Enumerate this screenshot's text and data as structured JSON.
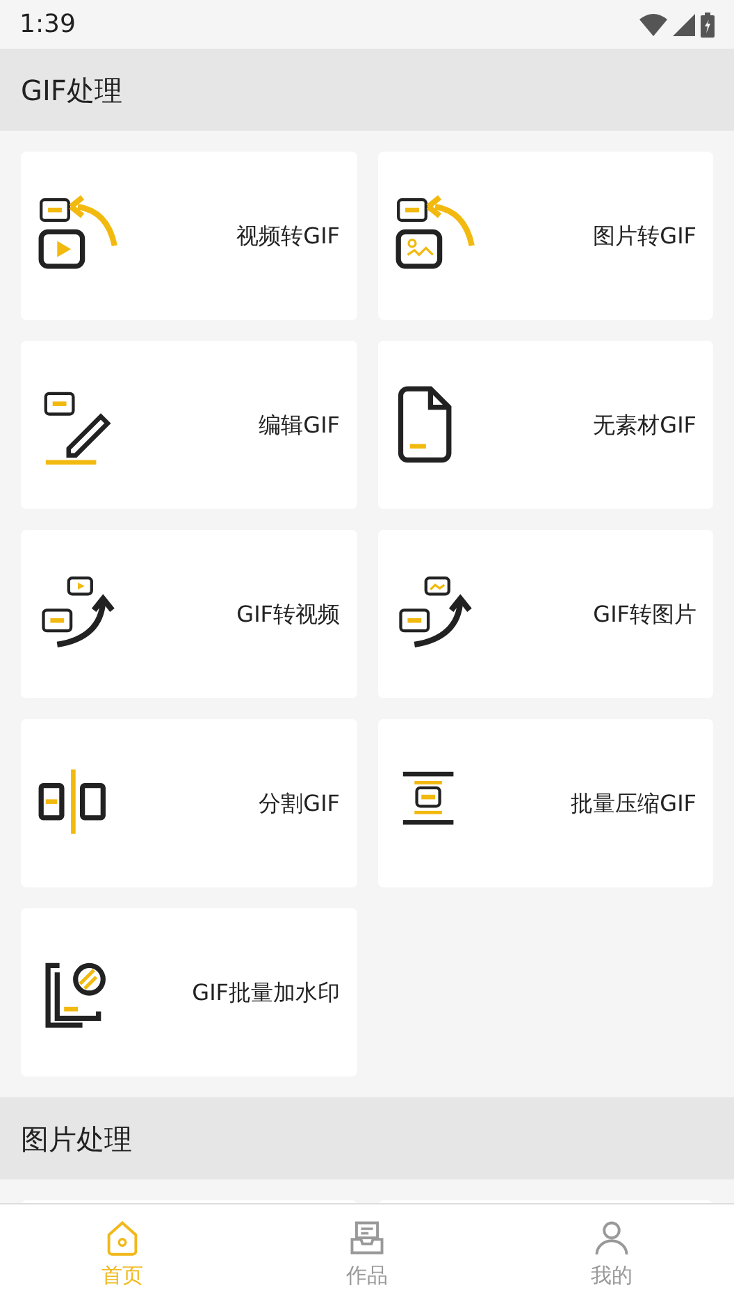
{
  "status_bar": {
    "time": "1:39"
  },
  "sections": [
    {
      "title": "GIF处理",
      "tools": [
        {
          "label": "视频转GIF",
          "kind": "video_to_gif"
        },
        {
          "label": "图片转GIF",
          "kind": "image_to_gif"
        },
        {
          "label": "编辑GIF",
          "kind": "edit"
        },
        {
          "label": "无素材GIF",
          "kind": "blank"
        },
        {
          "label": "GIF转视频",
          "kind": "gif_to_video"
        },
        {
          "label": "GIF转图片",
          "kind": "gif_to_image"
        },
        {
          "label": "分割GIF",
          "kind": "split"
        },
        {
          "label": "批量压缩GIF",
          "kind": "compress"
        },
        {
          "label": "GIF批量加水印",
          "kind": "watermark"
        }
      ]
    },
    {
      "title": "图片处理"
    }
  ],
  "bottom_nav": [
    {
      "label": "首页",
      "kind": "home",
      "selected": true
    },
    {
      "label": "作品",
      "kind": "works",
      "selected": false
    },
    {
      "label": "我的",
      "kind": "me",
      "selected": false
    }
  ]
}
